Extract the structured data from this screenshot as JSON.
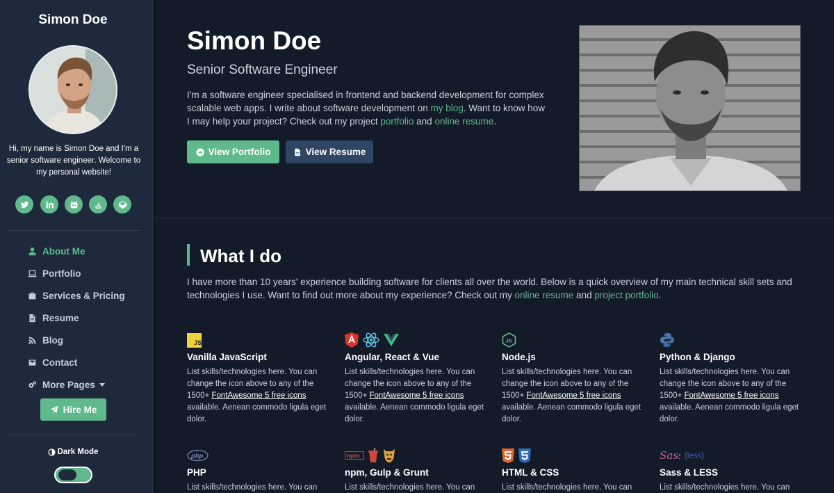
{
  "sidebar": {
    "name": "Simon Doe",
    "bio": "Hi, my name is Simon Doe and I'm a senior software engineer. Welcome to my personal website!",
    "socials": [
      "twitter-icon",
      "linkedin-icon",
      "github-icon",
      "stackoverflow-icon",
      "codepen-icon"
    ],
    "nav": [
      {
        "label": "About Me",
        "icon": "user-icon",
        "active": true
      },
      {
        "label": "Portfolio",
        "icon": "laptop-icon"
      },
      {
        "label": "Services & Pricing",
        "icon": "briefcase-icon"
      },
      {
        "label": "Resume",
        "icon": "file-icon"
      },
      {
        "label": "Blog",
        "icon": "blog-icon"
      },
      {
        "label": "Contact",
        "icon": "envelope-icon"
      },
      {
        "label": "More Pages",
        "icon": "cogs-icon"
      }
    ],
    "hire_label": "Hire Me",
    "dark_mode_label": "Dark Mode",
    "dark_mode_on": true
  },
  "hero": {
    "name": "Simon Doe",
    "title": "Senior Software Engineer",
    "intro_1": "I'm a software engineer specialised in frontend and backend development for complex scalable web apps. I write about software development on ",
    "intro_link_blog": "my blog",
    "intro_2": ". Want to know how I may help your project? Check out my project ",
    "intro_link_portfolio": "portfolio",
    "intro_3": " and ",
    "intro_link_resume": "online resume",
    "intro_4": ".",
    "btn_portfolio": "View Portfolio",
    "btn_resume": "View Resume"
  },
  "what_i_do": {
    "title": "What I do",
    "intro_1": "I have more than 10 years' experience building software for clients all over the world. Below is a quick overview of my main technical skill sets and technologies I use. Want to find out more about my experience? Check out my ",
    "intro_link_resume": "online resume",
    "intro_2": " and ",
    "intro_link_portfolio": "project portfolio",
    "intro_3": ".",
    "skills": [
      {
        "title": "Vanilla JavaScript",
        "icons": [
          "javascript-icon"
        ]
      },
      {
        "title": "Angular, React & Vue",
        "icons": [
          "angular-icon",
          "react-icon",
          "vue-icon"
        ]
      },
      {
        "title": "Node.js",
        "icons": [
          "nodejs-icon"
        ]
      },
      {
        "title": "Python & Django",
        "icons": [
          "python-icon"
        ]
      },
      {
        "title": "PHP",
        "icons": [
          "php-icon"
        ]
      },
      {
        "title": "npm, Gulp & Grunt",
        "icons": [
          "npm-icon",
          "gulp-icon",
          "grunt-icon"
        ]
      },
      {
        "title": "HTML & CSS",
        "icons": [
          "html5-icon",
          "css3-icon"
        ]
      },
      {
        "title": "Sass & LESS",
        "icons": [
          "sass-icon",
          "less-icon"
        ]
      }
    ],
    "skill_desc_1": "List skills/technologies here. You can change the icon above to any of the 1500+ ",
    "skill_desc_link": "FontAwesome 5 free icons",
    "skill_desc_2": " available. Aenean commodo ligula eget dolor.",
    "skill_desc_partial": "List skills/technologies here. You can"
  },
  "colors": {
    "accent": "#5fb98c",
    "sidebar_bg": "#1e2a3c",
    "page_bg": "#141b28",
    "resume_btn": "#2e4563"
  }
}
